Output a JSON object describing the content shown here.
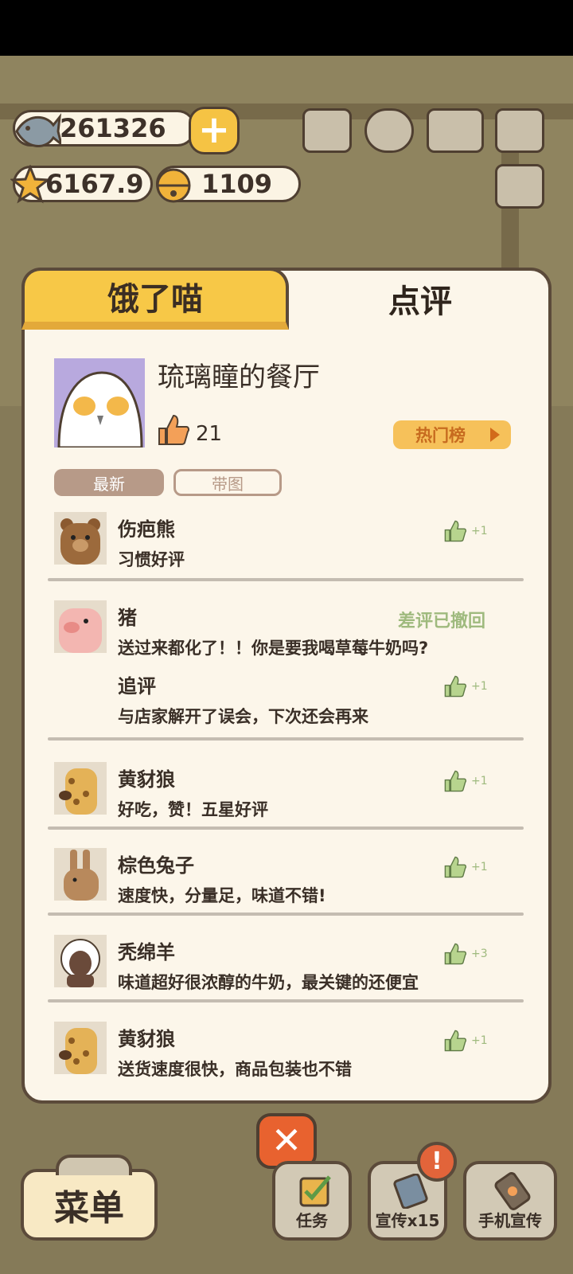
{
  "resources": {
    "fish": "261326",
    "stars": "6167.9",
    "bells": "1109"
  },
  "tabs": {
    "hungry": "饿了喵",
    "review": "点评"
  },
  "restaurant": {
    "name": "琉璃瞳的餐厅",
    "likes": "21",
    "hot_list": "热门榜"
  },
  "filters": {
    "latest": "最新",
    "with_pics": "带图"
  },
  "reviews": [
    {
      "name": "伤疤熊",
      "text": "习惯好评",
      "likes": "+1",
      "avatar": "bear"
    },
    {
      "name": "猪",
      "text": "送过来都化了！！你是要我喝草莓牛奶吗?",
      "status": "差评已撤回",
      "avatar": "pig",
      "followup_label": "追评",
      "followup_text": "与店家解开了误会，下次还会再来",
      "followup_likes": "+1"
    },
    {
      "name": "黄豺狼",
      "text": "好吃，赞！五星好评",
      "likes": "+1",
      "avatar": "hyena"
    },
    {
      "name": "棕色兔子",
      "text": "速度快，分量足，味道不错!",
      "likes": "+1",
      "avatar": "rabbit"
    },
    {
      "name": "秃绵羊",
      "text": "味道超好很浓醇的牛奶，最关键的还便宜",
      "likes": "+3",
      "avatar": "sheep"
    },
    {
      "name": "黄豺狼",
      "text": "送货速度很快，商品包装也不错",
      "likes": "+1",
      "avatar": "hyena"
    }
  ],
  "bottom": {
    "menu": "菜单",
    "close": "✕",
    "tasks": "任务",
    "promo": "宣传x15",
    "phone_promo": "手机宣传",
    "badge": "!"
  },
  "colors": {
    "accent_yellow": "#f7c847",
    "like_green": "#9fba7e",
    "close_orange": "#e8622f"
  }
}
